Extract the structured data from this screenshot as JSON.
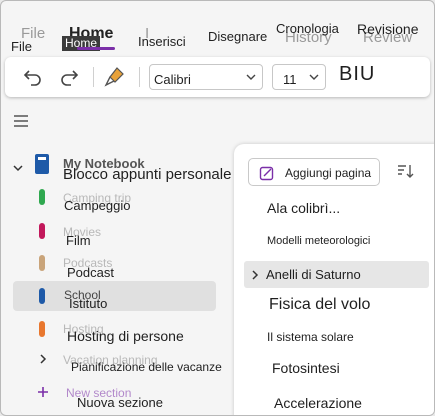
{
  "ribbon": {
    "tabs": {
      "file_ghost": "File",
      "file": "File",
      "home_ghost": "Home",
      "home": "Home",
      "insert_ghost": "I",
      "insert": "Inserisci",
      "draw": "Disegnare",
      "history_ghost": "History",
      "history": "Cronologia",
      "review_ghost": "Review",
      "review": "Revisione"
    },
    "accent": "#7b2fa8"
  },
  "toolbar": {
    "undo_icon": "undo-icon",
    "redo_icon": "redo-icon",
    "format_painter_icon": "format-painter-icon",
    "font_name": "Calibri",
    "font_size": "11",
    "biu": "BIU"
  },
  "notebook": {
    "ghost_name": "My Notebook",
    "name": "Blocco appunti personale",
    "sections": [
      {
        "ghost": "Camping trip",
        "label": "Campeggio",
        "color": "#2fa84f"
      },
      {
        "ghost": "Movies",
        "label": "Film",
        "color": "#c2185b"
      },
      {
        "ghost": "Podcasts",
        "label": "Podcast",
        "color": "#c9a47a"
      },
      {
        "ghost": "School",
        "label": "Istituto",
        "color": "#1e5aa8"
      },
      {
        "ghost": "Hosting",
        "label": "Hosting di persone",
        "color": "#e8772e"
      }
    ],
    "group": {
      "ghost": "Vacation planning",
      "label": "Pianificazione delle vacanze"
    },
    "new_section": {
      "ghost": "New section",
      "label": "Nuova sezione",
      "icon": "plus-icon"
    }
  },
  "pages": {
    "add_page": "Aggiungi pagina",
    "sort_icon": "sort-icon",
    "items": [
      {
        "label": "Ala colibrì...",
        "ghost": ""
      },
      {
        "label": "Modelli meteorologici",
        "ghost": ""
      },
      {
        "label": "Anelli di Saturno",
        "ghost": "A"
      },
      {
        "label": "Fisica del volo",
        "ghost": ""
      },
      {
        "label": "Il sistema solare",
        "ghost": "T"
      },
      {
        "label": "Fotosintesi",
        "ghost": "p"
      },
      {
        "label": "Accelerazione",
        "ghost": "A"
      }
    ]
  }
}
